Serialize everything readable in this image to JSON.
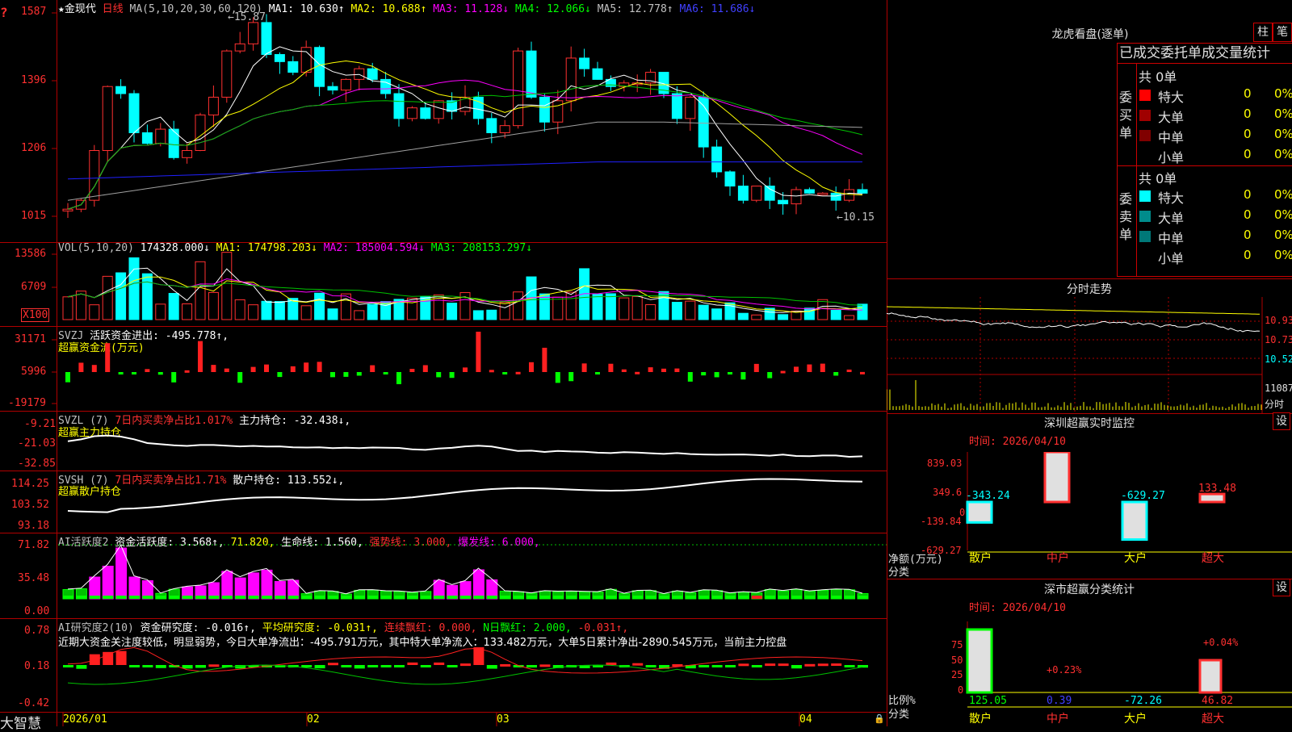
{
  "stock": {
    "name": "金现代",
    "period": "日线"
  },
  "main_panel": {
    "y_ticks": [
      "1587",
      "1396",
      "1206",
      "1015"
    ],
    "ma_title": "MA(5,10,20,30,60,120)",
    "ma1": "MA1: 10.630↑",
    "ma2": "MA2: 10.688↑",
    "ma3": "MA3: 11.128↓",
    "ma4": "MA4: 12.066↓",
    "ma5": "MA5: 12.778↑",
    "ma6": "MA6: 11.686↓",
    "high_marker": "←15.87",
    "low_marker": "←10.15"
  },
  "vol_panel": {
    "y_ticks": [
      "13586",
      "6709",
      "X100"
    ],
    "title": "VOL(5,10,20)",
    "vol": "174328.000↓",
    "ma1": "MA1: 174798.203↓",
    "ma2": "MA2: 185004.594↓",
    "ma3": "MA3: 208153.297↓"
  },
  "svzj_panel": {
    "y_ticks": [
      "31171",
      "5996",
      "-19179"
    ],
    "title": "SVZJ",
    "line1": "活跃资金进出: -495.778↑,",
    "line2": "超赢资金流(万元)"
  },
  "svzl_panel": {
    "y_ticks": [
      "-9.21",
      "-21.03",
      "-32.85"
    ],
    "title": "SVZL (7)",
    "ratio": "7日内买卖净占比1.017%",
    "hold": "主力持仓: -32.438↓,",
    "line2": "超赢主力持仓"
  },
  "svsh_panel": {
    "y_ticks": [
      "114.25",
      "103.52",
      "93.18"
    ],
    "title": "SVSH (7)",
    "ratio": "7日内买卖净占比1.71%",
    "hold": "散户持仓: 113.552↓,",
    "line2": "超赢散户持仓"
  },
  "ai_active_panel": {
    "y_ticks": [
      "71.82",
      "35.48",
      "0.00"
    ],
    "title": "AI活跃度2",
    "active": "资金活跃度: 3.568↑,",
    "v2": "71.820,",
    "life": "生命线: 1.560,",
    "strong": "强势线: 3.000,",
    "burst": "爆发线: 6.000,"
  },
  "ai_research_panel": {
    "y_ticks": [
      "0.78",
      "0.18",
      "-0.42"
    ],
    "title": "AI研究度2(10)",
    "research": "资金研究度: -0.016↑,",
    "avg": "平均研究度: -0.031↑,",
    "cont": "连续飘红: 0.000,",
    "nday": "N日飘红: 2.000,",
    "last": "-0.031↑,",
    "comment": "近期大资金关注度较低，明显弱势，今日大单净流出：-495.791万元，其中特大单净流入：133.482万元，大单5日累计净出-2890.545万元，当前主力控盘"
  },
  "x_axis": {
    "labels": [
      "2026/01",
      "02",
      "03",
      "04"
    ]
  },
  "brand": "大智慧",
  "right_panel": {
    "longhu": {
      "title": "龙虎看盘(逐单)",
      "btn_bar": "柱",
      "btn_pen": "笔",
      "header": "已成交委托单成交量统计",
      "buy_label": "委买单",
      "sell_label": "委卖单",
      "buy_total": "共 0单",
      "sell_total": "共 0单",
      "buy_rows": [
        {
          "name": "特大",
          "count": "0",
          "pct": "0%"
        },
        {
          "name": "大单",
          "count": "0",
          "pct": "0%"
        },
        {
          "name": "中单",
          "count": "0",
          "pct": "0%"
        },
        {
          "name": "小单",
          "count": "0",
          "pct": "0%"
        }
      ],
      "sell_rows": [
        {
          "name": "特大",
          "count": "0",
          "pct": "0%"
        },
        {
          "name": "大单",
          "count": "0",
          "pct": "0%"
        },
        {
          "name": "中单",
          "count": "0",
          "pct": "0%"
        },
        {
          "name": "小单",
          "count": "0",
          "pct": "0%"
        }
      ],
      "colors": {
        "buy": [
          "#ff0000",
          "#a00000",
          "#800000",
          "#000000"
        ],
        "sell": [
          "#00ffff",
          "#008c8c",
          "#007878",
          "#000000"
        ]
      }
    },
    "intraday": {
      "title": "分时走势",
      "y_ticks": [
        "10.93",
        "10.73",
        "10.52",
        "11087"
      ],
      "unit": "分时"
    },
    "monitor": {
      "title": "深圳超赢实时监控",
      "settings": "设",
      "time": "时间: 2026/04/10",
      "y_ticks": [
        "839.03",
        "349.6",
        "0",
        "-139.84",
        "-629.27"
      ],
      "y_label": "净额(万元)",
      "x_label": "分类",
      "categories": [
        "散户",
        "中户",
        "大户",
        "超大"
      ],
      "values": [
        -343.24,
        839.03,
        -629.27,
        133.48
      ],
      "value_labels": [
        "-343.24",
        "839.03",
        "-629.27",
        "133.48"
      ]
    },
    "classify": {
      "title": "深市超赢分类统计",
      "settings": "设",
      "time": "时间: 2026/04/10",
      "y_ticks": [
        "75",
        "50",
        "25",
        "0"
      ],
      "y_label": "比例%",
      "x_label": "分类",
      "categories": [
        "散户",
        "中户",
        "大户",
        "超大"
      ],
      "values": [
        "125.05",
        "0.39",
        "-72.26",
        "46.82"
      ],
      "annotations": [
        "+0.23%",
        "+0.04%"
      ]
    }
  }
}
